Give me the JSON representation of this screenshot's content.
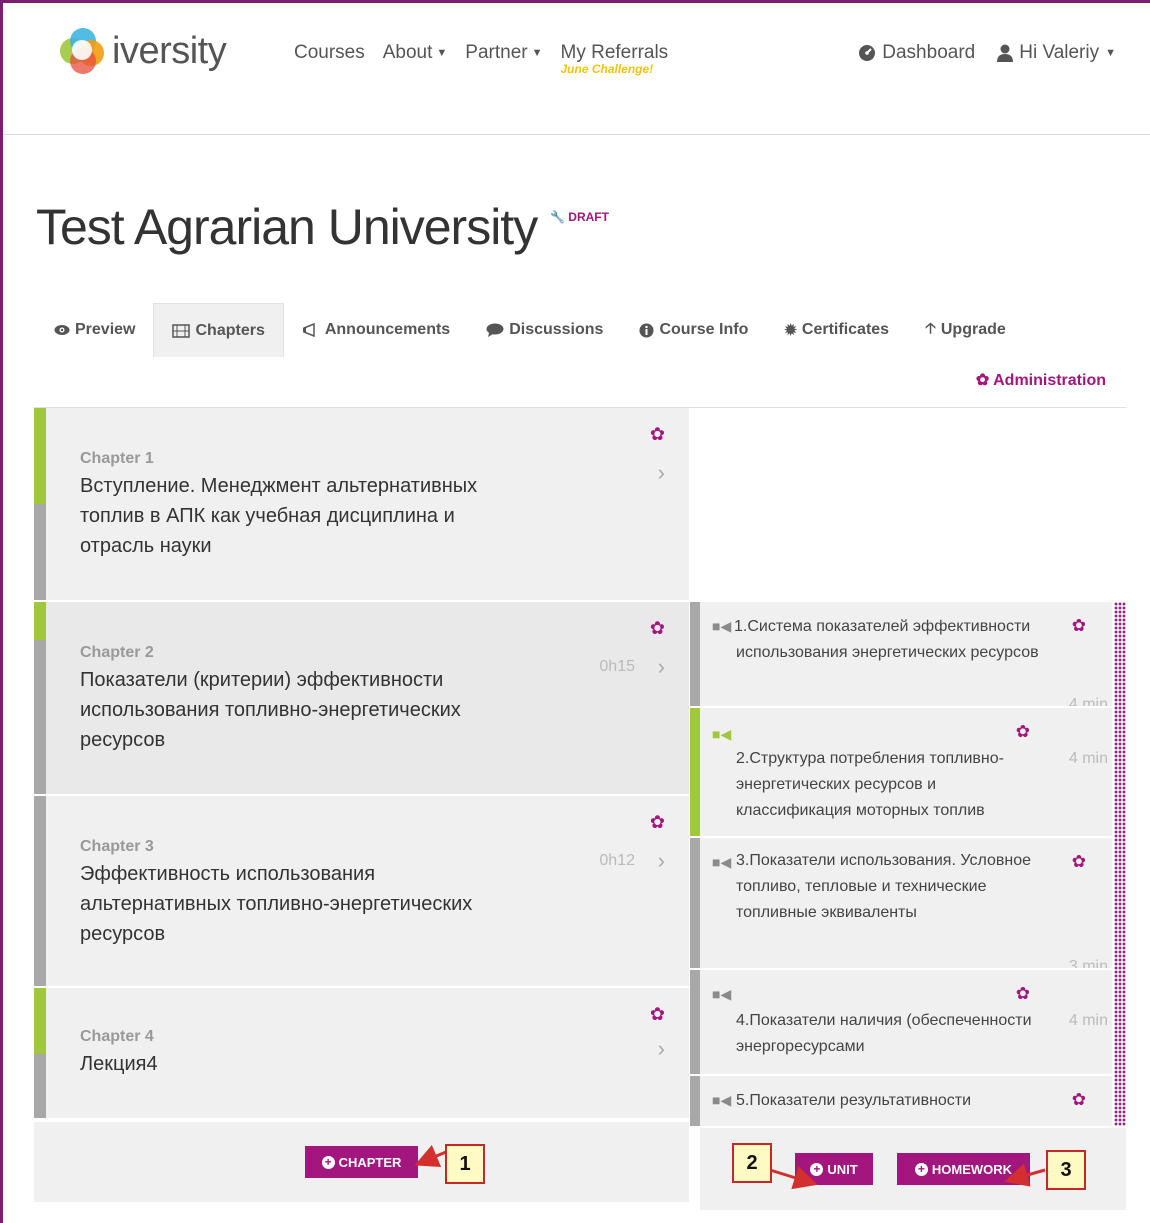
{
  "header": {
    "brand": "iversity",
    "nav": [
      {
        "label": "Courses",
        "dropdown": false
      },
      {
        "label": "About",
        "dropdown": true
      },
      {
        "label": "Partner",
        "dropdown": true
      }
    ],
    "referrals": {
      "label": "My Referrals",
      "tagline": "June Challenge!"
    },
    "dashboard": "Dashboard",
    "user": "Hi Valeriy"
  },
  "course": {
    "title": "Test Agrarian University",
    "status": "DRAFT"
  },
  "tabs": [
    {
      "label": "Preview",
      "icon": "eye-icon"
    },
    {
      "label": "Chapters",
      "icon": "film-icon",
      "active": true
    },
    {
      "label": "Announcements",
      "icon": "bullhorn-icon"
    },
    {
      "label": "Discussions",
      "icon": "comment-icon"
    },
    {
      "label": "Course Info",
      "icon": "info-icon"
    },
    {
      "label": "Certificates",
      "icon": "certificate-icon"
    },
    {
      "label": "Upgrade",
      "icon": "arrow-up-icon"
    }
  ],
  "administration": "Administration",
  "chapters": [
    {
      "label": "Chapter 1",
      "name": "Вступление. Менеджмент альтернативных топлив в АПК как учебная дисциплина и отрасль науки",
      "duration": ""
    },
    {
      "label": "Chapter 2",
      "name": "Показатели (критерии) эффективности использования топливно-энергетических ресурсов",
      "duration": "0h15"
    },
    {
      "label": "Chapter 3",
      "name": "Эффективность использования альтернативных топливно-энергетических ресурсов",
      "duration": "0h12"
    },
    {
      "label": "Chapter 4",
      "name": "Лекция4",
      "duration": ""
    }
  ],
  "units": [
    {
      "title": "1.Система показателей эффективности использования энергетических ресурсов",
      "minutes": "4 min"
    },
    {
      "title": "2.Структура потребления топливно-энергетических ресурсов и классификация моторных топлив",
      "minutes": "4 min"
    },
    {
      "title": "3.Показатели использования. Условное топливо, тепловые и технические топливные эквиваленты",
      "minutes": "3 min"
    },
    {
      "title": "4.Показатели наличия (обеспеченности энергоресурсами",
      "minutes": "4 min"
    },
    {
      "title": "5.Показатели результативности",
      "minutes": ""
    }
  ],
  "buttons": {
    "chapter": "CHAPTER",
    "unit": "UNIT",
    "homework": "HOMEWORK"
  },
  "callouts": [
    "1",
    "2",
    "3"
  ],
  "colors": {
    "accent": "#a3167e",
    "green": "#9fc83c",
    "gray_bar": "#a8a8a8",
    "callout_bg": "#fff9c4",
    "callout_border": "#c62828"
  }
}
